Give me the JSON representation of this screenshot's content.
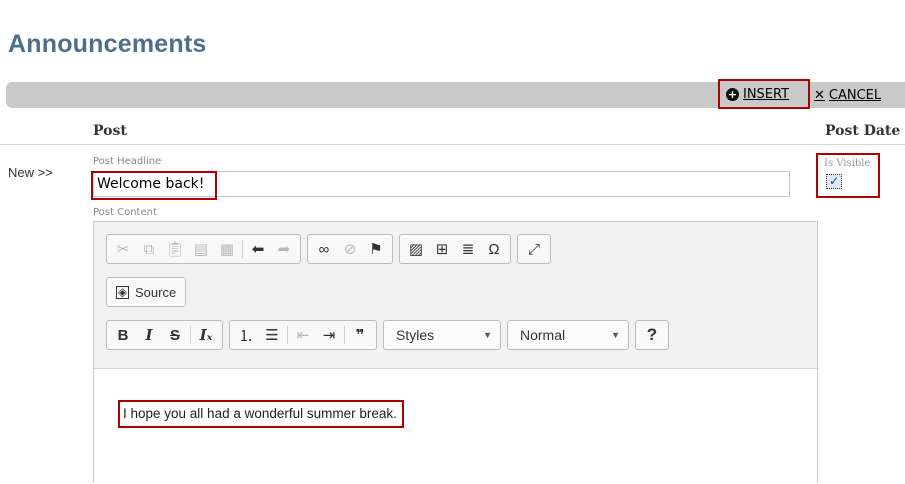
{
  "page": {
    "title": "Announcements"
  },
  "actions": {
    "insert_label": "INSERT",
    "cancel_label": "CANCEL"
  },
  "table": {
    "col_post": "Post",
    "col_post_date": "Post Date"
  },
  "row": {
    "new_label": "New >>",
    "headline_label": "Post Headline",
    "headline_value": "Welcome back!",
    "content_label": "Post Content",
    "visible_label": "Is Visible",
    "visible_checked": true
  },
  "editor": {
    "source_label": "Source",
    "styles_label": "Styles",
    "format_label": "Normal",
    "help_label": "?",
    "content": "I hope you all had a wonderful summer break."
  },
  "icons": {
    "insert": "plus-circle-icon",
    "cancel": "x-icon",
    "toolbar_row1": [
      "cut-icon",
      "copy-icon",
      "paste-icon",
      "paste-text-icon",
      "paste-word-icon",
      "undo-icon",
      "redo-icon",
      "link-icon",
      "unlink-icon",
      "anchor-flag-icon",
      "image-icon",
      "table-icon",
      "horizontal-rule-icon",
      "special-char-icon",
      "maximize-icon"
    ],
    "toolbar_row3": [
      "bold-icon",
      "italic-icon",
      "strike-icon",
      "remove-format-icon",
      "numbered-list-icon",
      "bullet-list-icon",
      "outdent-icon",
      "indent-icon",
      "blockquote-icon"
    ]
  },
  "colors": {
    "title": "#4e6e8e",
    "highlight": "#b00000",
    "bar": "#c9c9c9"
  }
}
